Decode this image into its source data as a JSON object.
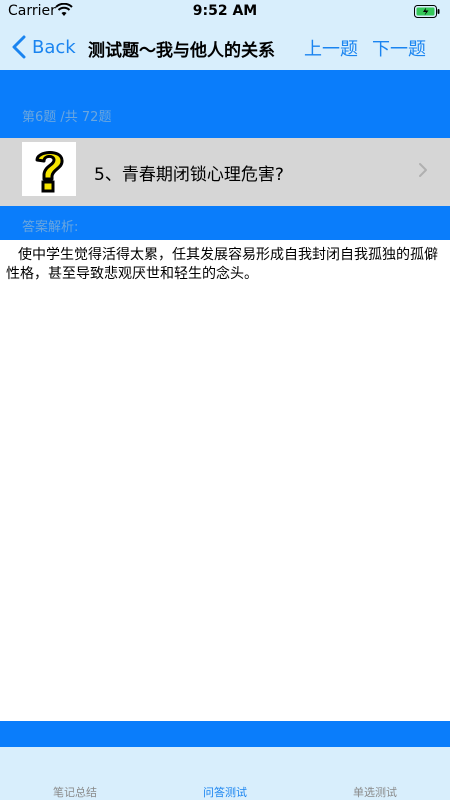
{
  "status_bar": {
    "carrier": "Carrier",
    "time": "9:52 AM"
  },
  "nav": {
    "back_label": "Back",
    "title": "测试题～我与他人的关系",
    "prev_label": "上一题",
    "next_label": "下一题"
  },
  "progress": {
    "label": "第6题 /共 72题"
  },
  "question": {
    "icon": "question-mark-icon",
    "text": "5、青春期闭锁心理危害?"
  },
  "answer": {
    "header": "答案解析:",
    "body": "使中学生觉得活得太累，任其发展容易形成自我封闭自我孤独的孤僻性格，甚至导致悲观厌世和轻生的念头。"
  },
  "tabs": [
    {
      "label": "笔记总结"
    },
    {
      "label": "问答测试",
      "active": true
    },
    {
      "label": "单选测试"
    }
  ],
  "colors": {
    "accent": "#1a84f0",
    "section_blue": "#0a7dfb",
    "bar_background": "#d8eefc",
    "question_row": "#d6d6d6"
  }
}
